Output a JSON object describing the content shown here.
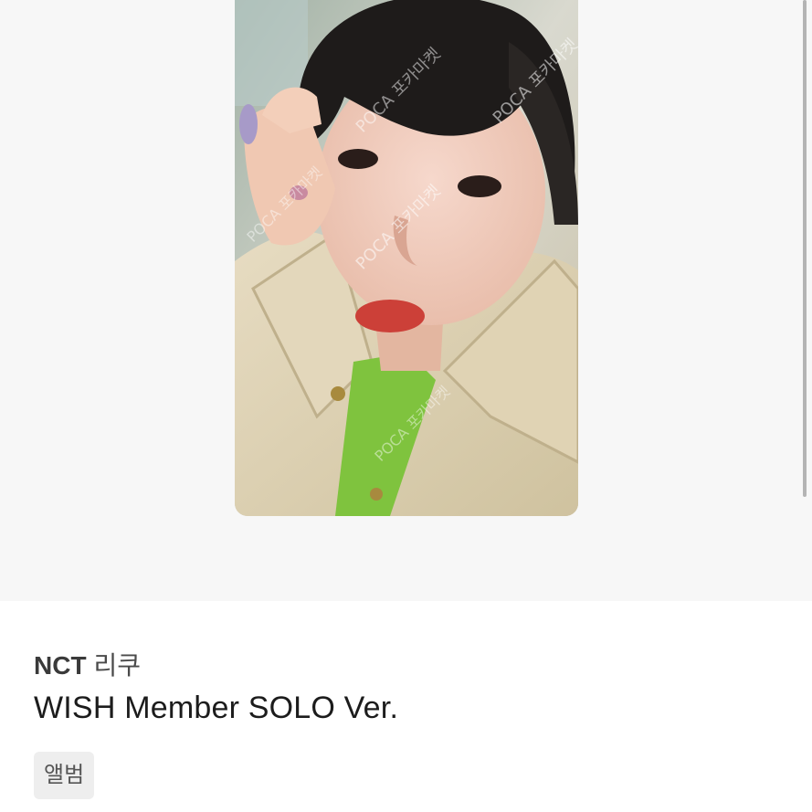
{
  "product": {
    "image_alt": "NCT 리쿠 WISH Member SOLO Ver. photocard",
    "watermark": "POCA 포카마켓",
    "artist_group": "NCT",
    "artist_member": "리쿠",
    "title": "WISH Member SOLO Ver.",
    "tag": "앨범"
  },
  "colors": {
    "image_bg": "#f7f7f7",
    "tag_bg": "#eeeeee",
    "title_text": "#1c1c1c"
  }
}
